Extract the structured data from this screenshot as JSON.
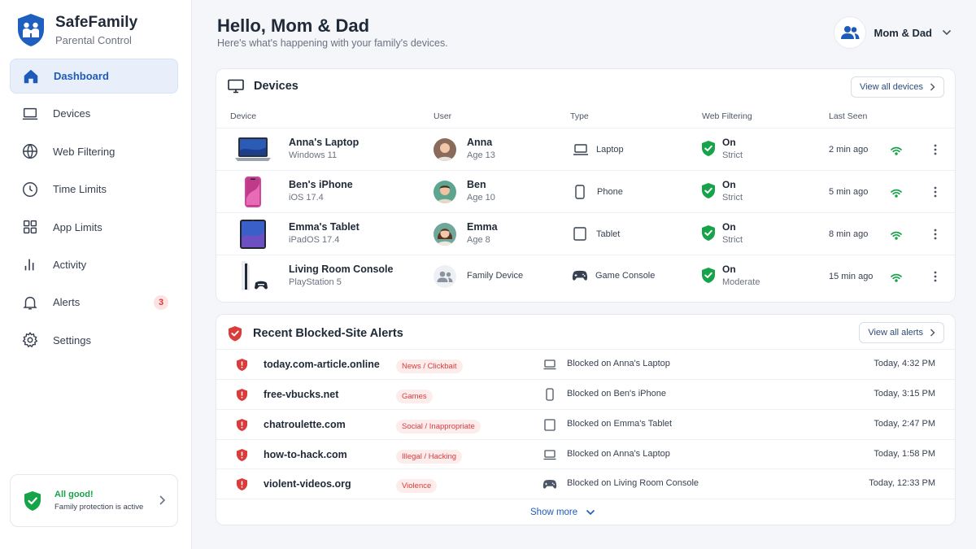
{
  "brand": {
    "name": "SafeFamily",
    "subtitle": "Parental Control"
  },
  "nav": [
    {
      "label": "Dashboard",
      "icon": "home-icon",
      "active": true
    },
    {
      "label": "Devices",
      "icon": "laptop-icon"
    },
    {
      "label": "Web Filtering",
      "icon": "globe-icon"
    },
    {
      "label": "Time Limits",
      "icon": "clock-icon"
    },
    {
      "label": "App Limits",
      "icon": "grid-icon"
    },
    {
      "label": "Activity",
      "icon": "activity-icon"
    },
    {
      "label": "Alerts",
      "icon": "bell-icon",
      "badge": "3"
    },
    {
      "label": "Settings",
      "icon": "gear-icon"
    }
  ],
  "status": {
    "title": "All good!",
    "subtitle": "Family protection is active"
  },
  "header": {
    "greeting": "Hello, Mom & Dad",
    "subtitle": "Here's what's happening with your family's devices.",
    "user": "Mom & Dad"
  },
  "devices": {
    "title": "Devices",
    "view_all": "View all devices",
    "columns": [
      "Device",
      "User",
      "Type",
      "Web Filtering",
      "Last Seen"
    ],
    "rows": [
      {
        "name": "Anna's Laptop",
        "os": "Windows 11",
        "user": "Anna",
        "age": "Age 13",
        "type": "Laptop",
        "filter": "On",
        "level": "Strict",
        "last_seen": "2 min ago"
      },
      {
        "name": "Ben's iPhone",
        "os": "iOS 17.4",
        "user": "Ben",
        "age": "Age 10",
        "type": "Phone",
        "filter": "On",
        "level": "Strict",
        "last_seen": "5 min ago"
      },
      {
        "name": "Emma's Tablet",
        "os": "iPadOS 17.4",
        "user": "Emma",
        "age": "Age 8",
        "type": "Tablet",
        "filter": "On",
        "level": "Strict",
        "last_seen": "8 min ago"
      },
      {
        "name": "Living Room Console",
        "os": "PlayStation 5",
        "user": "Family Device",
        "age": "",
        "type": "Game Console",
        "filter": "On",
        "level": "Moderate",
        "last_seen": "15 min ago"
      }
    ]
  },
  "alerts": {
    "title": "Recent Blocked-Site Alerts",
    "view_all": "View all alerts",
    "show_more": "Show more",
    "rows": [
      {
        "domain": "today.com-article.online",
        "category": "News / Clickbait",
        "blocked_on": "Blocked on Anna's Laptop",
        "time": "Today, 4:32 PM"
      },
      {
        "domain": "free-vbucks.net",
        "category": "Games",
        "blocked_on": "Blocked on Ben's iPhone",
        "time": "Today, 3:15 PM"
      },
      {
        "domain": "chatroulette.com",
        "category": "Social / Inappropriate",
        "blocked_on": "Blocked on Emma's Tablet",
        "time": "Today, 2:47 PM"
      },
      {
        "domain": "how-to-hack.com",
        "category": "Illegal / Hacking",
        "blocked_on": "Blocked on Anna's Laptop",
        "time": "Today, 1:58 PM"
      },
      {
        "domain": "violent-videos.org",
        "category": "Violence",
        "blocked_on": "Blocked on Living Room Console",
        "time": "Today, 12:33 PM"
      }
    ]
  },
  "colors": {
    "accent": "#1e5bb8",
    "success": "#16a34a",
    "danger": "#dc3b3b",
    "brand_shield": "#1f5fbf"
  }
}
